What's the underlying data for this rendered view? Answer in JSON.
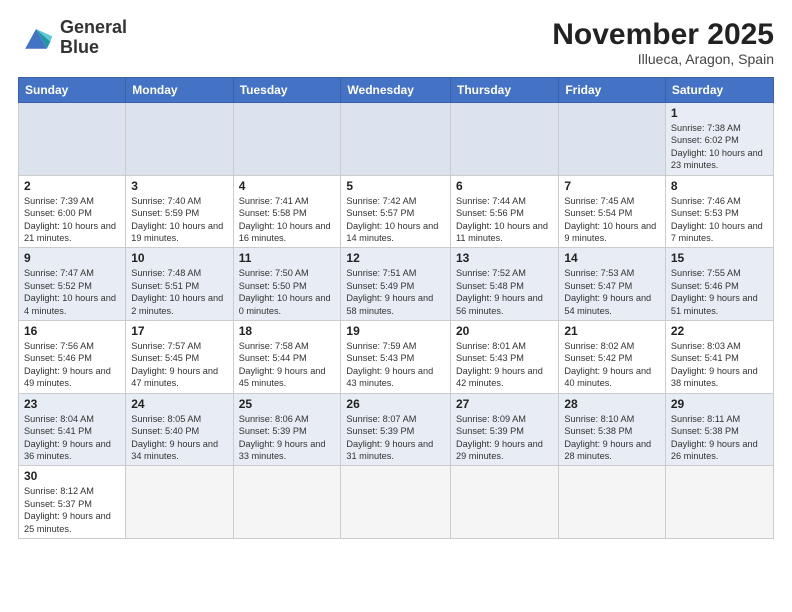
{
  "logo": {
    "line1": "General",
    "line2": "Blue"
  },
  "title": "November 2025",
  "subtitle": "Illueca, Aragon, Spain",
  "days_of_week": [
    "Sunday",
    "Monday",
    "Tuesday",
    "Wednesday",
    "Thursday",
    "Friday",
    "Saturday"
  ],
  "weeks": [
    [
      {
        "day": "",
        "info": "",
        "empty": true
      },
      {
        "day": "",
        "info": "",
        "empty": true
      },
      {
        "day": "",
        "info": "",
        "empty": true
      },
      {
        "day": "",
        "info": "",
        "empty": true
      },
      {
        "day": "",
        "info": "",
        "empty": true
      },
      {
        "day": "",
        "info": "",
        "empty": true
      },
      {
        "day": "1",
        "info": "Sunrise: 7:38 AM\nSunset: 6:02 PM\nDaylight: 10 hours and 23 minutes."
      }
    ],
    [
      {
        "day": "2",
        "info": "Sunrise: 7:39 AM\nSunset: 6:00 PM\nDaylight: 10 hours and 21 minutes."
      },
      {
        "day": "3",
        "info": "Sunrise: 7:40 AM\nSunset: 5:59 PM\nDaylight: 10 hours and 19 minutes."
      },
      {
        "day": "4",
        "info": "Sunrise: 7:41 AM\nSunset: 5:58 PM\nDaylight: 10 hours and 16 minutes."
      },
      {
        "day": "5",
        "info": "Sunrise: 7:42 AM\nSunset: 5:57 PM\nDaylight: 10 hours and 14 minutes."
      },
      {
        "day": "6",
        "info": "Sunrise: 7:44 AM\nSunset: 5:56 PM\nDaylight: 10 hours and 11 minutes."
      },
      {
        "day": "7",
        "info": "Sunrise: 7:45 AM\nSunset: 5:54 PM\nDaylight: 10 hours and 9 minutes."
      },
      {
        "day": "8",
        "info": "Sunrise: 7:46 AM\nSunset: 5:53 PM\nDaylight: 10 hours and 7 minutes."
      }
    ],
    [
      {
        "day": "9",
        "info": "Sunrise: 7:47 AM\nSunset: 5:52 PM\nDaylight: 10 hours and 4 minutes."
      },
      {
        "day": "10",
        "info": "Sunrise: 7:48 AM\nSunset: 5:51 PM\nDaylight: 10 hours and 2 minutes."
      },
      {
        "day": "11",
        "info": "Sunrise: 7:50 AM\nSunset: 5:50 PM\nDaylight: 10 hours and 0 minutes."
      },
      {
        "day": "12",
        "info": "Sunrise: 7:51 AM\nSunset: 5:49 PM\nDaylight: 9 hours and 58 minutes."
      },
      {
        "day": "13",
        "info": "Sunrise: 7:52 AM\nSunset: 5:48 PM\nDaylight: 9 hours and 56 minutes."
      },
      {
        "day": "14",
        "info": "Sunrise: 7:53 AM\nSunset: 5:47 PM\nDaylight: 9 hours and 54 minutes."
      },
      {
        "day": "15",
        "info": "Sunrise: 7:55 AM\nSunset: 5:46 PM\nDaylight: 9 hours and 51 minutes."
      }
    ],
    [
      {
        "day": "16",
        "info": "Sunrise: 7:56 AM\nSunset: 5:46 PM\nDaylight: 9 hours and 49 minutes."
      },
      {
        "day": "17",
        "info": "Sunrise: 7:57 AM\nSunset: 5:45 PM\nDaylight: 9 hours and 47 minutes."
      },
      {
        "day": "18",
        "info": "Sunrise: 7:58 AM\nSunset: 5:44 PM\nDaylight: 9 hours and 45 minutes."
      },
      {
        "day": "19",
        "info": "Sunrise: 7:59 AM\nSunset: 5:43 PM\nDaylight: 9 hours and 43 minutes."
      },
      {
        "day": "20",
        "info": "Sunrise: 8:01 AM\nSunset: 5:43 PM\nDaylight: 9 hours and 42 minutes."
      },
      {
        "day": "21",
        "info": "Sunrise: 8:02 AM\nSunset: 5:42 PM\nDaylight: 9 hours and 40 minutes."
      },
      {
        "day": "22",
        "info": "Sunrise: 8:03 AM\nSunset: 5:41 PM\nDaylight: 9 hours and 38 minutes."
      }
    ],
    [
      {
        "day": "23",
        "info": "Sunrise: 8:04 AM\nSunset: 5:41 PM\nDaylight: 9 hours and 36 minutes."
      },
      {
        "day": "24",
        "info": "Sunrise: 8:05 AM\nSunset: 5:40 PM\nDaylight: 9 hours and 34 minutes."
      },
      {
        "day": "25",
        "info": "Sunrise: 8:06 AM\nSunset: 5:39 PM\nDaylight: 9 hours and 33 minutes."
      },
      {
        "day": "26",
        "info": "Sunrise: 8:07 AM\nSunset: 5:39 PM\nDaylight: 9 hours and 31 minutes."
      },
      {
        "day": "27",
        "info": "Sunrise: 8:09 AM\nSunset: 5:39 PM\nDaylight: 9 hours and 29 minutes."
      },
      {
        "day": "28",
        "info": "Sunrise: 8:10 AM\nSunset: 5:38 PM\nDaylight: 9 hours and 28 minutes."
      },
      {
        "day": "29",
        "info": "Sunrise: 8:11 AM\nSunset: 5:38 PM\nDaylight: 9 hours and 26 minutes."
      }
    ],
    [
      {
        "day": "30",
        "info": "Sunrise: 8:12 AM\nSunset: 5:37 PM\nDaylight: 9 hours and 25 minutes."
      },
      {
        "day": "",
        "info": "",
        "empty": true
      },
      {
        "day": "",
        "info": "",
        "empty": true
      },
      {
        "day": "",
        "info": "",
        "empty": true
      },
      {
        "day": "",
        "info": "",
        "empty": true
      },
      {
        "day": "",
        "info": "",
        "empty": true
      },
      {
        "day": "",
        "info": "",
        "empty": true
      }
    ]
  ]
}
